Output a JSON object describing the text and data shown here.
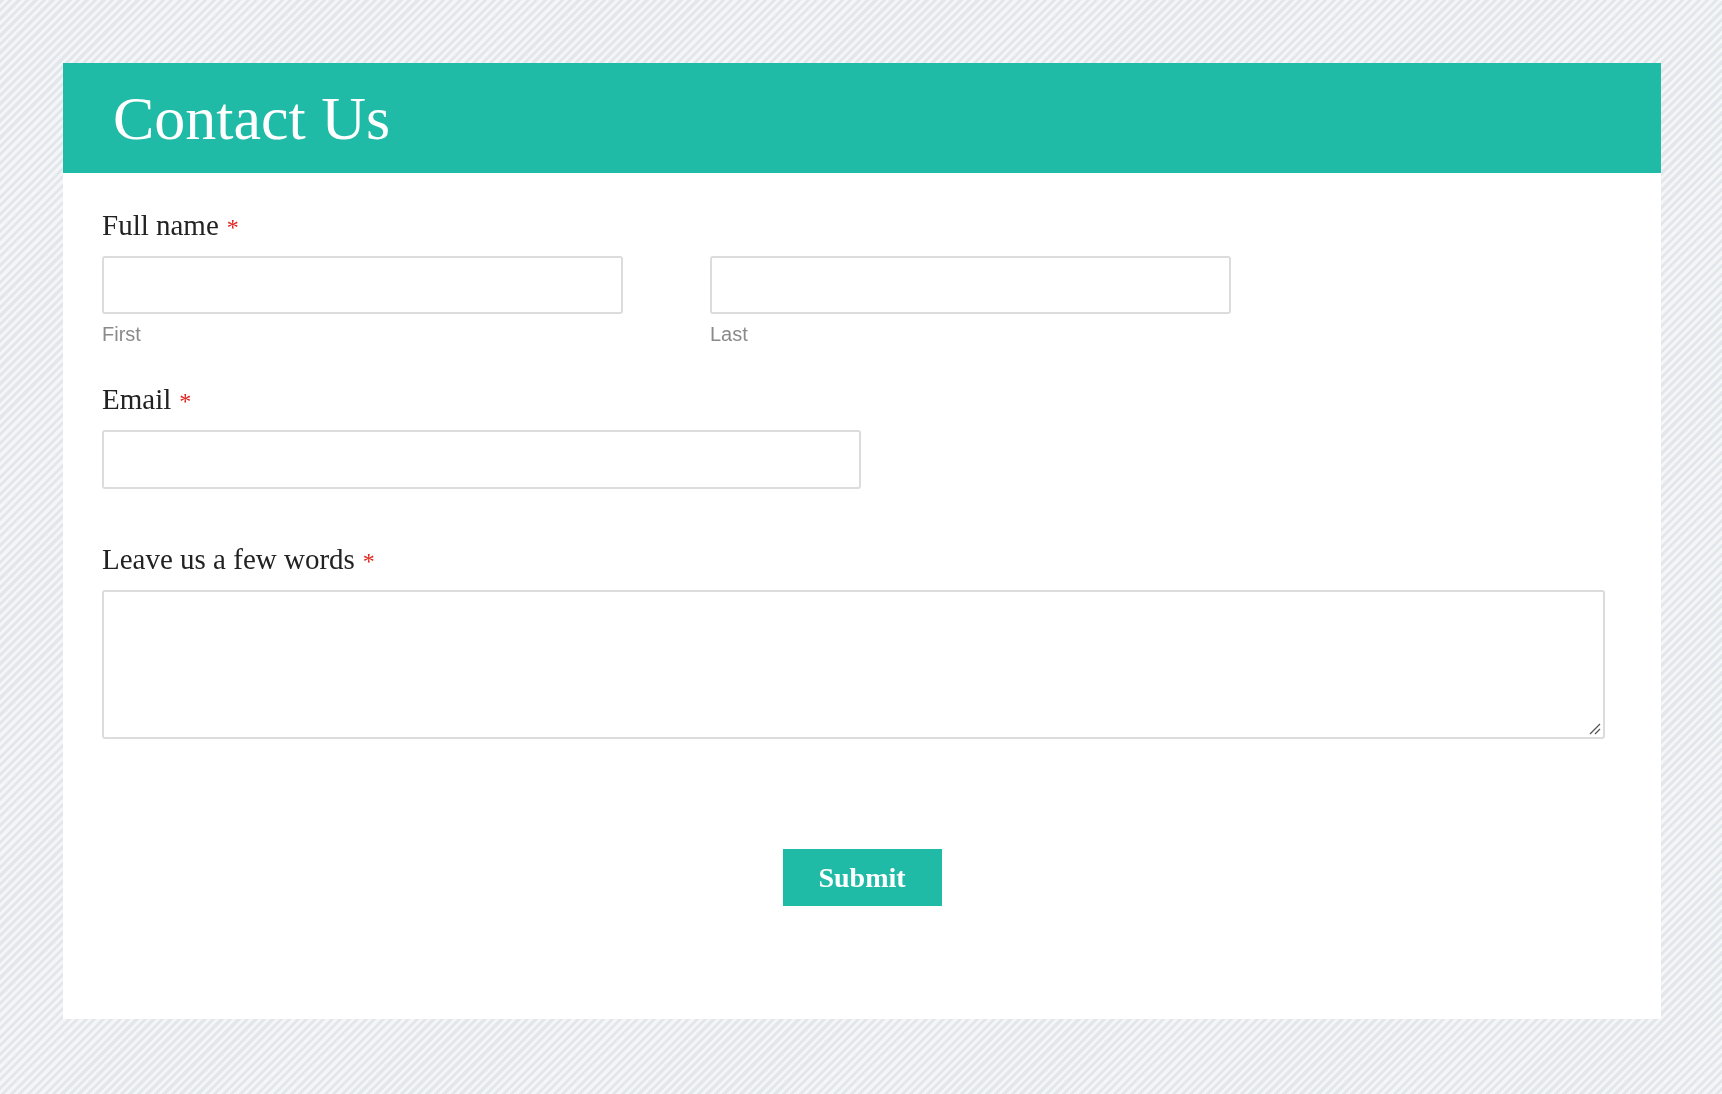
{
  "header": {
    "title": "Contact Us"
  },
  "fields": [
    {
      "kind": "name",
      "label": "Full name",
      "required_mark": "*",
      "parts": [
        {
          "sublabel": "First"
        },
        {
          "sublabel": "Last"
        }
      ]
    },
    {
      "kind": "email",
      "label": "Email",
      "required_mark": "*"
    },
    {
      "kind": "textarea",
      "label": "Leave us a few words",
      "required_mark": "*"
    }
  ],
  "submit": {
    "label": "Submit"
  }
}
